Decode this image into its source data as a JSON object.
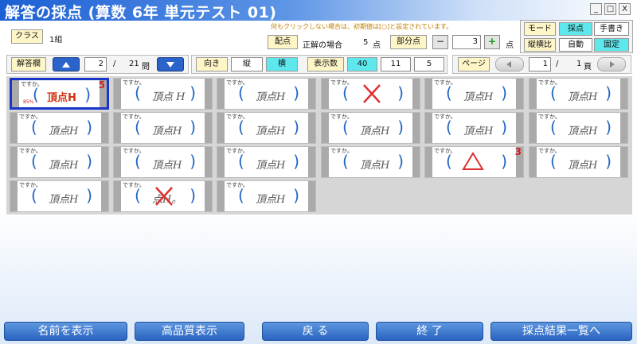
{
  "window": {
    "title": "解答の採点 (算数 6年 単元テスト 01)",
    "min": "_",
    "max": "□",
    "close": "X"
  },
  "class": {
    "button": "クラス",
    "value": "1組"
  },
  "notice": "何もクリックしない場合は、初期値は[○]と設定されています。",
  "points": {
    "button": "配点",
    "label": "正解の場合",
    "value": "5",
    "unit": "点"
  },
  "partial": {
    "button": "部分点",
    "minus": "−",
    "value": "3",
    "plus": "+",
    "unit": "点"
  },
  "mode": {
    "label": "モード",
    "opt1": "採点",
    "opt2": "手書き"
  },
  "ratio": {
    "label": "縦横比",
    "opt1": "自動",
    "opt2": "固定"
  },
  "answer_field": {
    "label": "解答欄",
    "current": "2",
    "sep": "/",
    "total": "21",
    "unit": "問"
  },
  "orientation": {
    "label": "向き",
    "opt1": "縦",
    "opt2": "横"
  },
  "display_count": {
    "label": "表示数",
    "v1": "40",
    "v2": "11",
    "v3": "5"
  },
  "page": {
    "label": "ページ",
    "current": "1",
    "sep": "/",
    "total": "1",
    "unit": "頁"
  },
  "cells": [
    {
      "q": "ですか。",
      "text": "頂点H",
      "mark": "",
      "score": "5",
      "pct": "85%",
      "selected": true
    },
    {
      "q": "ですか。",
      "text": "頂点 H",
      "mark": "",
      "score": ""
    },
    {
      "q": "ですか。",
      "text": "頂点H",
      "mark": "",
      "score": ""
    },
    {
      "q": "ですか。",
      "text": "",
      "mark": "x",
      "score": ""
    },
    {
      "q": "ですか。",
      "text": "頂点H",
      "mark": "",
      "score": ""
    },
    {
      "q": "ですか。",
      "text": "頂点H",
      "mark": "",
      "score": ""
    },
    {
      "q": "ですか。",
      "text": "頂点H",
      "mark": "",
      "score": ""
    },
    {
      "q": "ですか。",
      "text": "頂点H",
      "mark": "",
      "score": ""
    },
    {
      "q": "ですか。",
      "text": "頂点H",
      "mark": "",
      "score": ""
    },
    {
      "q": "ですか。",
      "text": "頂点H",
      "mark": "",
      "score": ""
    },
    {
      "q": "ですか。",
      "text": "頂点H",
      "mark": "",
      "score": ""
    },
    {
      "q": "ですか。",
      "text": "頂点H",
      "mark": "",
      "score": ""
    },
    {
      "q": "ですか。",
      "text": "頂点H",
      "mark": "",
      "score": ""
    },
    {
      "q": "ですか。",
      "text": "頂点H",
      "mark": "",
      "score": ""
    },
    {
      "q": "ですか。",
      "text": "頂点H",
      "mark": "",
      "score": ""
    },
    {
      "q": "ですか。",
      "text": "頂点H",
      "mark": "",
      "score": ""
    },
    {
      "q": "ですか。",
      "text": "",
      "mark": "triangle",
      "score": "3"
    },
    {
      "q": "ですか。",
      "text": "頂点H",
      "mark": "",
      "score": ""
    },
    {
      "q": "ですか。",
      "text": "頂点H",
      "mark": "",
      "score": ""
    },
    {
      "q": "ですか。",
      "text": "点H。",
      "mark": "x",
      "score": ""
    },
    {
      "q": "ですか。",
      "text": "頂点H",
      "mark": "",
      "score": ""
    }
  ],
  "bottom": {
    "b1": "名前を表示",
    "b2": "高品質表示",
    "b3": "戻 る",
    "b4": "終 了",
    "b5": "採点結果一覧へ"
  },
  "colors": {
    "accent": "#2a64c0",
    "cyan": "#5ee8ee",
    "mark_red": "#d02020"
  }
}
